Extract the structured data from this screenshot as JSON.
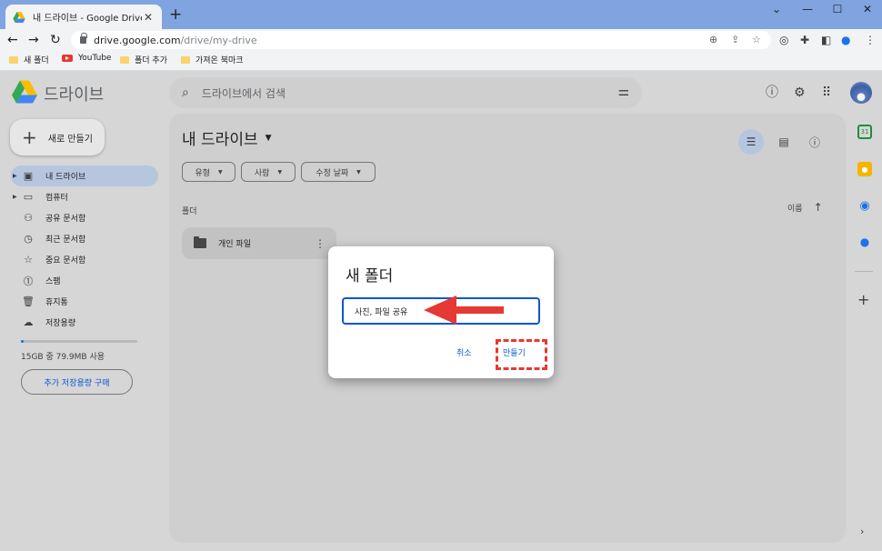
{
  "browser": {
    "tab_title": "내 드라이브 - Google Drive",
    "tab_close": "✕",
    "new_tab": "+",
    "window_controls": [
      "⌄",
      "—",
      "☐",
      "✕"
    ],
    "url_host": "drive.google.com",
    "url_path": "/drive/my-drive",
    "bookmarks": [
      {
        "label": "새 폴더",
        "icon": "folder-icon"
      },
      {
        "label": "YouTube",
        "icon": "youtube-icon"
      },
      {
        "label": "폴더 추가",
        "icon": "folder-icon"
      },
      {
        "label": "가져온 북마크",
        "icon": "folder-icon"
      }
    ]
  },
  "drive": {
    "logo_text": "드라이브",
    "search_placeholder": "드라이브에서 검색",
    "new_button": "새로 만들기",
    "nav": [
      {
        "label": "내 드라이브",
        "icon": "my-drive-icon",
        "active": true
      },
      {
        "label": "컴퓨터",
        "icon": "computer-icon"
      },
      {
        "label": "공유 문서함",
        "icon": "shared-icon"
      },
      {
        "label": "최근 문서함",
        "icon": "recent-icon"
      },
      {
        "label": "중요 문서함",
        "icon": "star-icon"
      },
      {
        "label": "스팸",
        "icon": "spam-icon"
      },
      {
        "label": "휴지통",
        "icon": "trash-icon"
      },
      {
        "label": "저장용량",
        "icon": "cloud-icon"
      }
    ],
    "storage_text": "15GB 중 79.9MB 사용",
    "storage_used_percent": 0.5,
    "buy_storage": "추가 저장용량 구매",
    "page_title": "내 드라이브",
    "filters": [
      "유형",
      "사람",
      "수정 날짜"
    ],
    "section_label": "폴더",
    "sort_label": "이름",
    "folders": [
      {
        "name": "개인 파일"
      }
    ]
  },
  "dialog": {
    "title": "새 폴더",
    "input_value": "사진, 파일 공유",
    "cancel": "취소",
    "create": "만들기"
  },
  "colors": {
    "accent": "#0b57d0",
    "annotation": "#e53935",
    "active_nav": "#b6c6df"
  }
}
